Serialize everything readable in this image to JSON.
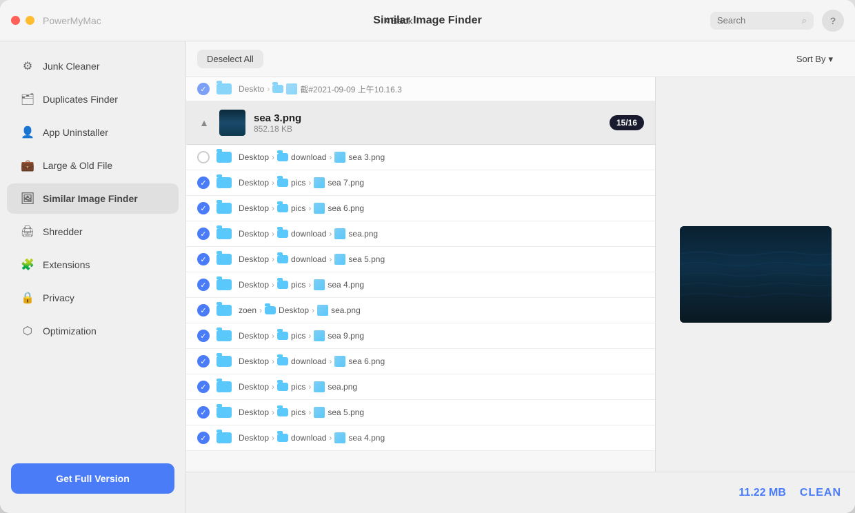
{
  "app": {
    "name": "PowerMyMac",
    "title": "Similar Image Finder",
    "back_label": "Back",
    "help_label": "?"
  },
  "search": {
    "placeholder": "Search"
  },
  "sidebar": {
    "items": [
      {
        "id": "junk-cleaner",
        "label": "Junk Cleaner",
        "icon": "⚙"
      },
      {
        "id": "duplicates-finder",
        "label": "Duplicates Finder",
        "icon": "🗂"
      },
      {
        "id": "app-uninstaller",
        "label": "App Uninstaller",
        "icon": "👤"
      },
      {
        "id": "large-old-file",
        "label": "Large & Old File",
        "icon": "💼"
      },
      {
        "id": "similar-image-finder",
        "label": "Similar Image Finder",
        "icon": "🖼",
        "active": true
      },
      {
        "id": "shredder",
        "label": "Shredder",
        "icon": "🖨"
      },
      {
        "id": "extensions",
        "label": "Extensions",
        "icon": "🧩"
      },
      {
        "id": "privacy",
        "label": "Privacy",
        "icon": "🔒"
      },
      {
        "id": "optimization",
        "label": "Optimization",
        "icon": "⬡"
      }
    ],
    "get_full_version_label": "Get Full Version"
  },
  "toolbar": {
    "deselect_all_label": "Deselect All",
    "sort_by_label": "Sort By"
  },
  "group": {
    "name": "sea 3.png",
    "size": "852.18 KB",
    "badge": "15/16"
  },
  "file_items": [
    {
      "checked": false,
      "folder": "Desktop",
      "subfolder": "download",
      "filename": "sea 3.png"
    },
    {
      "checked": true,
      "folder": "Desktop",
      "subfolder": "pics",
      "filename": "sea 7.png"
    },
    {
      "checked": true,
      "folder": "Desktop",
      "subfolder": "pics",
      "filename": "sea 6.png"
    },
    {
      "checked": true,
      "folder": "Desktop",
      "subfolder": "download",
      "filename": "sea.png"
    },
    {
      "checked": true,
      "folder": "Desktop",
      "subfolder": "download",
      "filename": "sea 5.png"
    },
    {
      "checked": true,
      "folder": "Desktop",
      "subfolder": "pics",
      "filename": "sea 4.png"
    },
    {
      "checked": true,
      "folder": "zoen",
      "subfolder": "Desktop",
      "filename": "sea.png"
    },
    {
      "checked": true,
      "folder": "Desktop",
      "subfolder": "pics",
      "filename": "sea 9.png"
    },
    {
      "checked": true,
      "folder": "Desktop",
      "subfolder": "download",
      "filename": "sea 6.png"
    },
    {
      "checked": true,
      "folder": "Desktop",
      "subfolder": "pics",
      "filename": "sea.png"
    },
    {
      "checked": true,
      "folder": "Desktop",
      "subfolder": "pics",
      "filename": "sea 5.png"
    },
    {
      "checked": true,
      "folder": "Desktop",
      "subfolder": "download",
      "filename": "sea 4.png"
    }
  ],
  "bottom": {
    "total_size": "11.22 MB",
    "clean_label": "CLEAN"
  },
  "truncated_row": {
    "folder": "Deskto",
    "filename": "截#2021-09-09 上午10.16.3"
  }
}
